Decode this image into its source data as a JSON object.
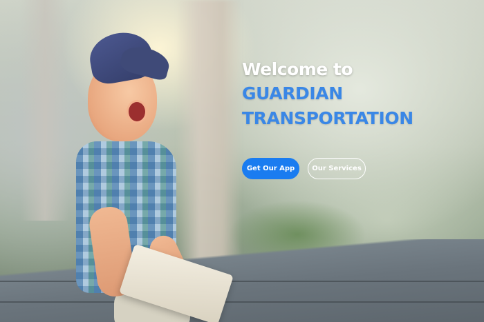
{
  "hero": {
    "welcome_line": "Welcome to",
    "brand_line_1": "GUARDIAN",
    "brand_line_2": "TRANSPORTATION",
    "accent_color": "#3a87e6"
  },
  "actions": {
    "primary_label": "Get Our App",
    "secondary_label": "Our Services",
    "primary_color": "#1a7cf0"
  }
}
